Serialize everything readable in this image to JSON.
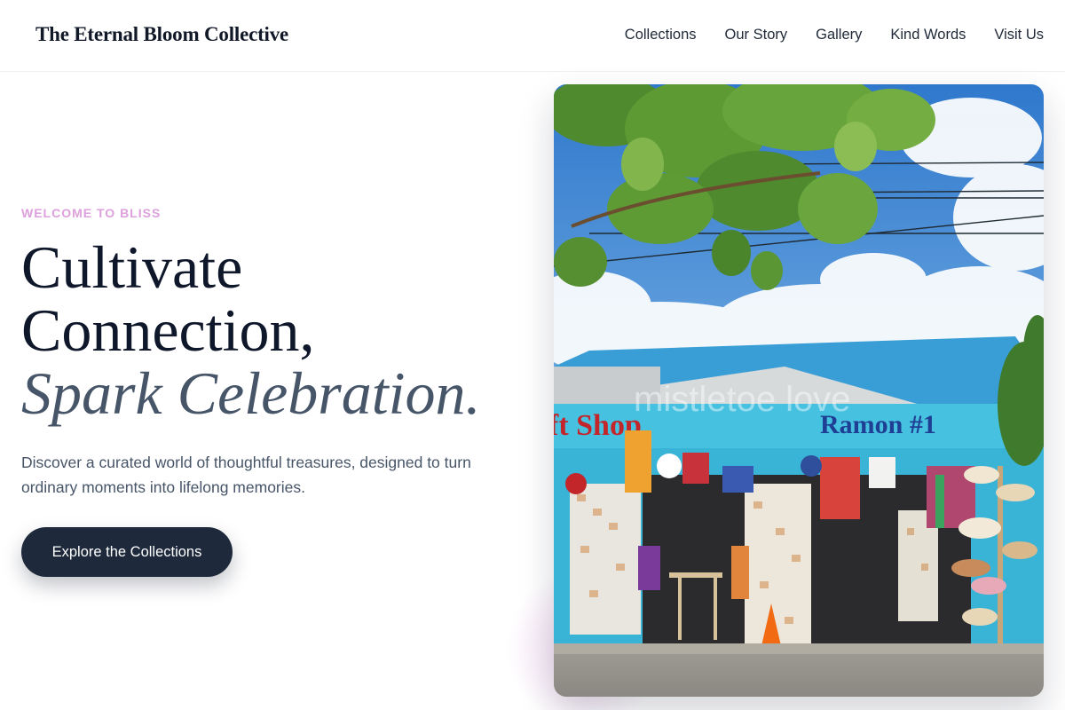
{
  "header": {
    "brand": "The Eternal Bloom Collective",
    "nav": [
      "Collections",
      "Our Story",
      "Gallery",
      "Kind Words",
      "Visit Us"
    ]
  },
  "hero": {
    "eyebrow": "WELCOME TO BLISS",
    "headline_line1": "Cultivate",
    "headline_line2": "Connection,",
    "headline_accent": "Spark Celebration.",
    "description": "Discover a curated world of thoughtful treasures, designed to turn ordinary moments into lifelong memories.",
    "cta_label": "Explore the Collections"
  },
  "photo": {
    "sign_left": "ft Shop",
    "sign_right": "Ramon #1",
    "watermark": "mistletoe love"
  },
  "colors": {
    "eyebrow": "#dda0dd",
    "headline": "#0f172a",
    "accent": "#475569",
    "cta_bg": "#1e293b",
    "sky": "#3f86d4",
    "shop_blue": "#39b4d6"
  }
}
